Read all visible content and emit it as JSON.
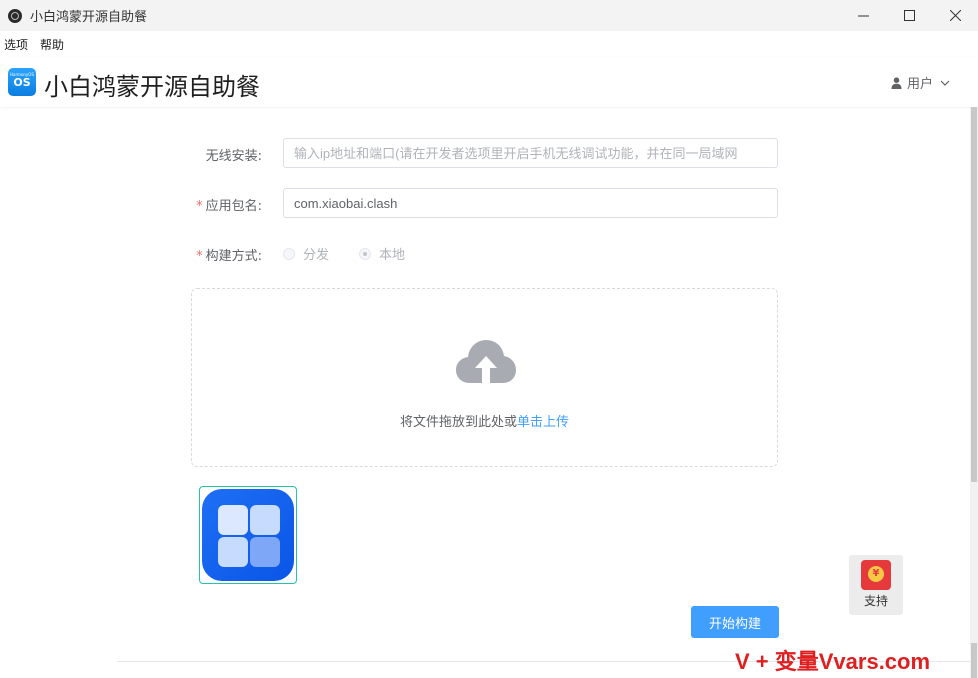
{
  "window": {
    "title": "小白鸿蒙开源自助餐",
    "minimize_icon": "minimize-icon",
    "maximize_icon": "maximize-icon",
    "close_icon": "close-icon"
  },
  "menu": {
    "options": "选项",
    "help": "帮助"
  },
  "header": {
    "logo_small": "HarmonyOS",
    "logo_text": "OS",
    "title": "小白鸿蒙开源自助餐",
    "user_label": "用户"
  },
  "form": {
    "wireless_label": "无线安装:",
    "wireless_placeholder": "输入ip地址和端口(请在开发者选项里开启手机无线调试功能，并在同一局域网",
    "package_label": "应用包名:",
    "package_value": "com.xiaobai.clash",
    "build_label": "构建方式:",
    "build_options": [
      "分发",
      "本地"
    ],
    "build_selected": "本地"
  },
  "upload": {
    "text": "将文件拖放到此处或",
    "link": "单击上传"
  },
  "actions": {
    "build_button": "开始构建"
  },
  "support": {
    "label": "支持",
    "coin": "¥"
  },
  "watermark": "V + 变量Vvars.com",
  "colors": {
    "primary": "#409eff",
    "required": "#f56c6c",
    "thumb_border": "#27c3a8",
    "watermark": "#e02020"
  }
}
